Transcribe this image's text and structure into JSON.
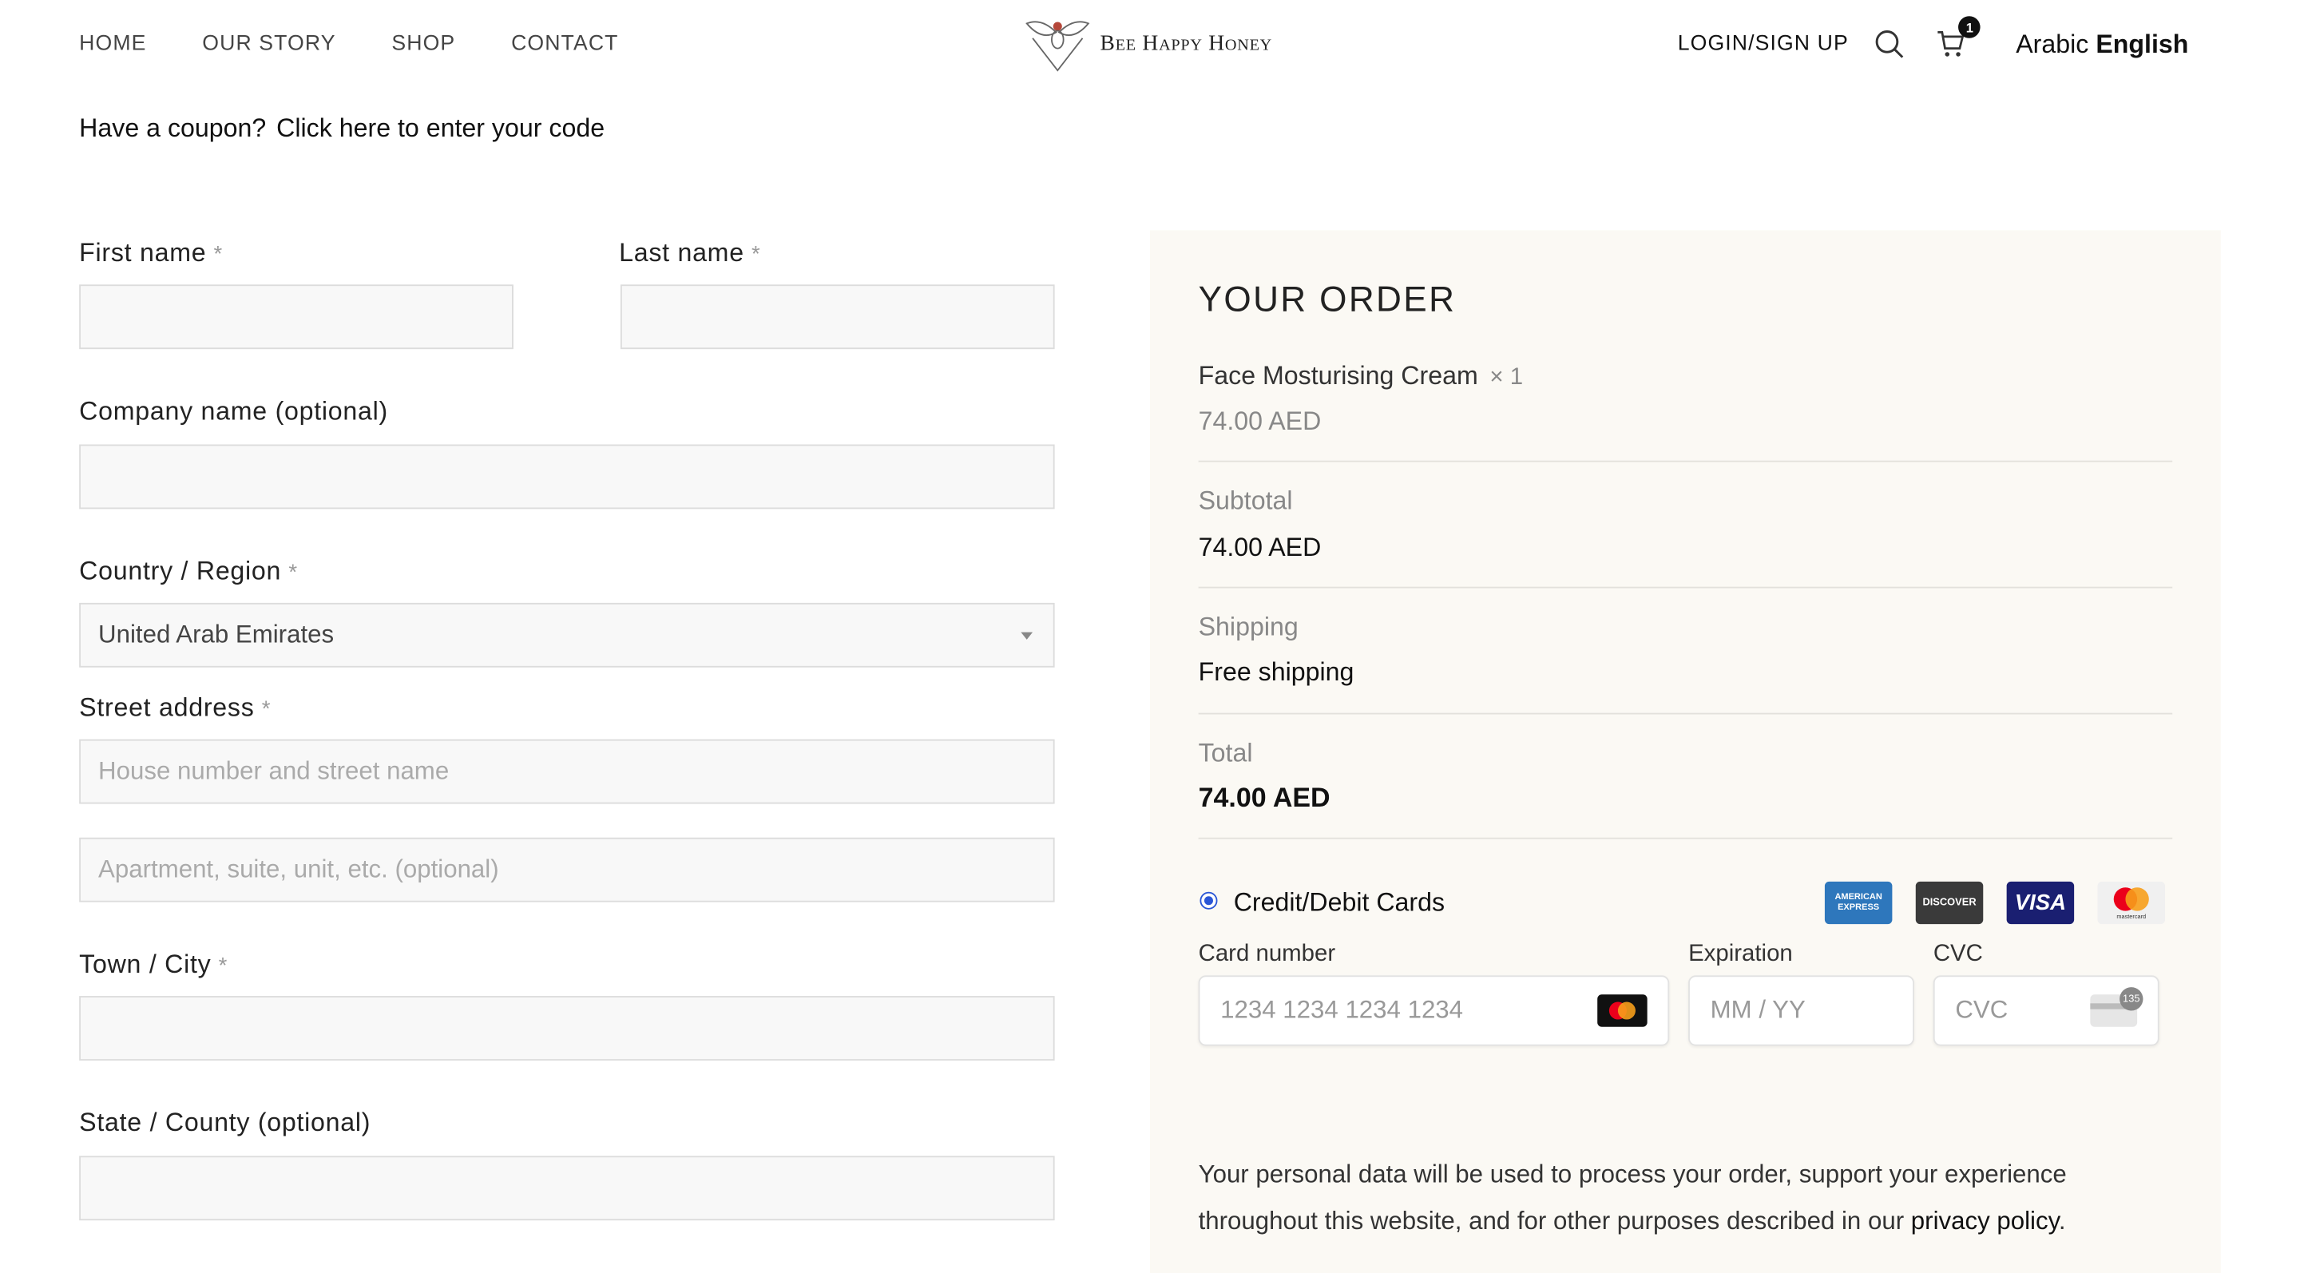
{
  "nav": {
    "items": [
      "HOME",
      "OUR STORY",
      "SHOP",
      "CONTACT"
    ]
  },
  "brand": {
    "name": "Bee Happy Honey"
  },
  "header": {
    "login": "LOGIN/SIGN UP",
    "cart_count": "1",
    "lang_arabic": "Arabic",
    "lang_english": "English",
    "search_icon": "search-icon",
    "cart_icon": "cart-icon"
  },
  "coupon": {
    "question": "Have a coupon?",
    "link": "Click here to enter your code"
  },
  "form": {
    "required_mark": "*",
    "first_name": {
      "label": "First name",
      "value": ""
    },
    "last_name": {
      "label": "Last name",
      "value": ""
    },
    "company": {
      "label": "Company name (optional)",
      "value": ""
    },
    "country": {
      "label": "Country / Region",
      "value": "United Arab Emirates"
    },
    "street": {
      "label": "Street address",
      "placeholder1": "House number and street name",
      "placeholder2": "Apartment, suite, unit, etc. (optional)"
    },
    "city": {
      "label": "Town / City",
      "value": ""
    },
    "state": {
      "label": "State / County (optional)",
      "value": ""
    }
  },
  "order": {
    "title": "YOUR ORDER",
    "item_name": "Face Mosturising Cream",
    "item_qty": "× 1",
    "item_price": "74.00 AED",
    "subtotal_label": "Subtotal",
    "subtotal_value": "74.00 AED",
    "shipping_label": "Shipping",
    "shipping_value": "Free shipping",
    "total_label": "Total",
    "total_value": "74.00 AED",
    "payment_method": "Credit/Debit Cards",
    "card_brands": [
      "AMERICAN EXPRESS",
      "DISCOVER",
      "VISA",
      "mastercard"
    ],
    "card_number_label": "Card number",
    "card_number_placeholder": "1234 1234 1234 1234",
    "expiration_label": "Expiration",
    "expiration_placeholder": "MM / YY",
    "cvc_label": "CVC",
    "cvc_placeholder": "CVC",
    "cvc_hint": "135",
    "privacy_text": "Your personal data will be used to process your order, support your experience throughout this website, and for other purposes described in our",
    "privacy_link": "privacy policy",
    "privacy_end": "."
  },
  "colors": {
    "panel_bg": "#fbf9f4",
    "radio_blue": "#2a56d6",
    "amex": "#2e77bc",
    "visa": "#1a1f71",
    "mastercard_red": "#eb001b",
    "mastercard_orange": "#f79e1b"
  }
}
